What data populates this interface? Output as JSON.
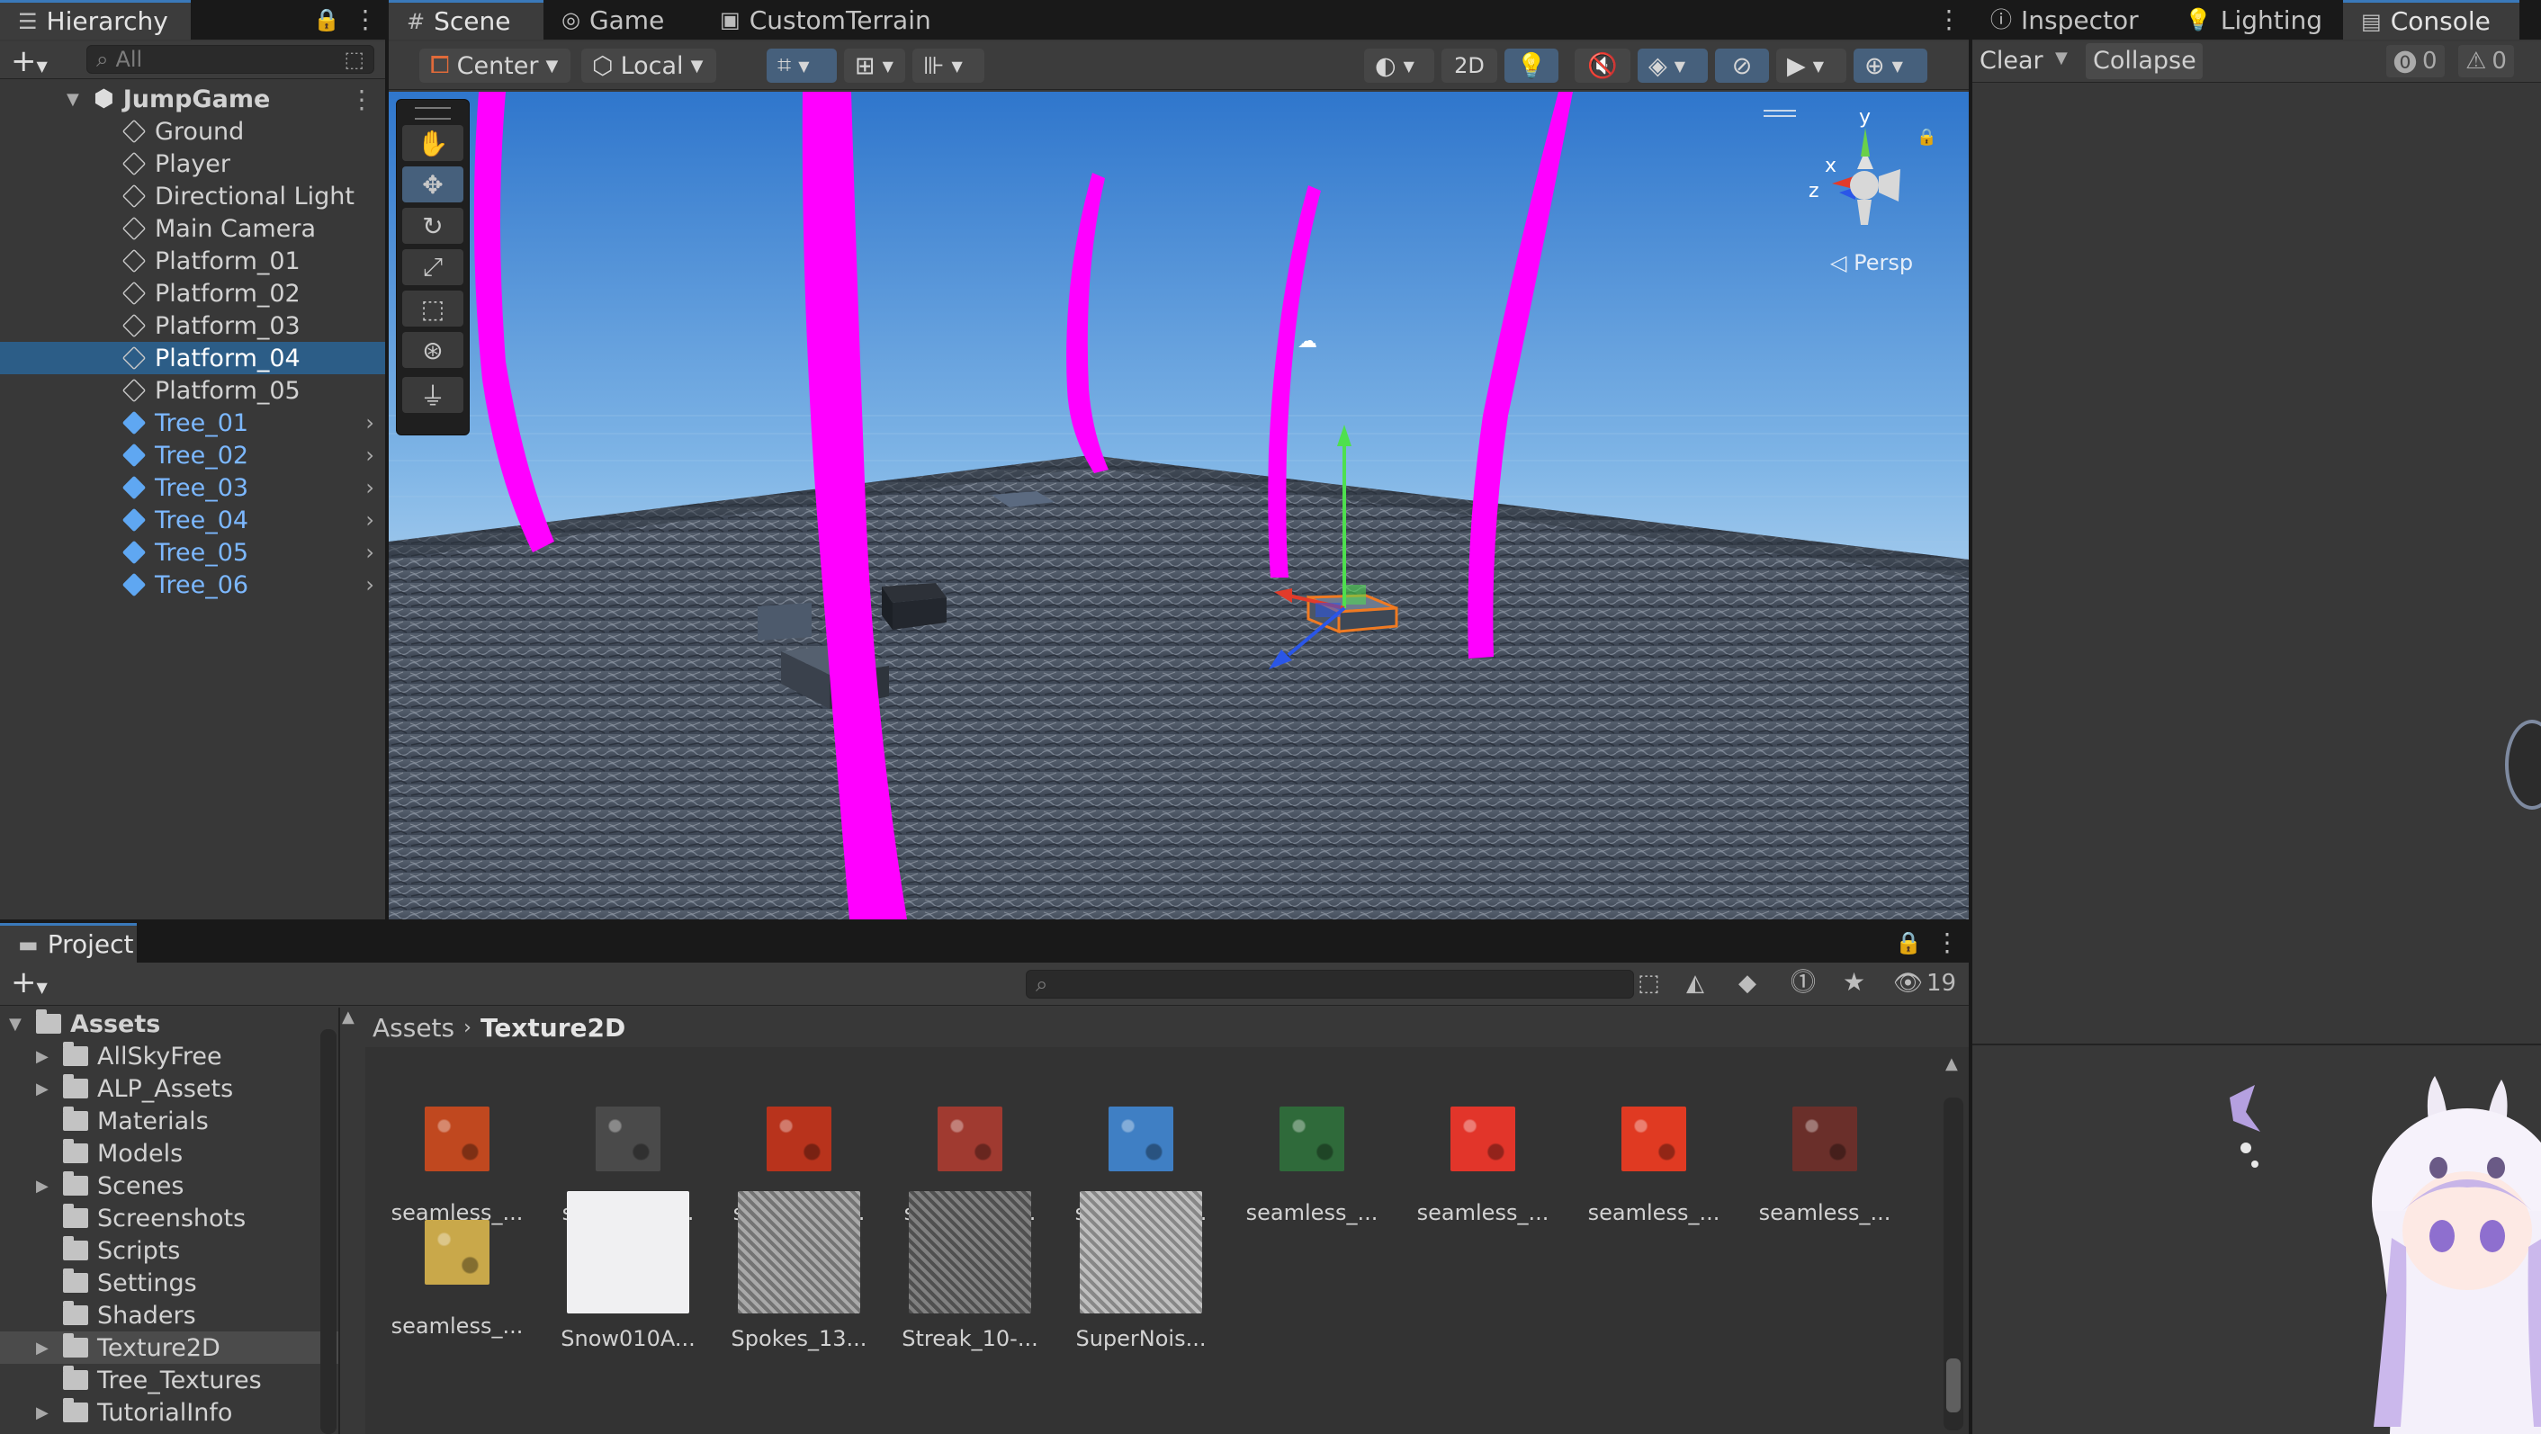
{
  "hierarchy": {
    "tab": "Hierarchy",
    "search_placeholder": "All",
    "root": "JumpGame",
    "items": [
      {
        "label": "Ground",
        "prefab": false
      },
      {
        "label": "Player",
        "prefab": false
      },
      {
        "label": "Directional Light",
        "prefab": false
      },
      {
        "label": "Main Camera",
        "prefab": false
      },
      {
        "label": "Platform_01",
        "prefab": false
      },
      {
        "label": "Platform_02",
        "prefab": false
      },
      {
        "label": "Platform_03",
        "prefab": false
      },
      {
        "label": "Platform_04",
        "prefab": false,
        "selected": true
      },
      {
        "label": "Platform_05",
        "prefab": false
      },
      {
        "label": "Tree_01",
        "prefab": true
      },
      {
        "label": "Tree_02",
        "prefab": true
      },
      {
        "label": "Tree_03",
        "prefab": true
      },
      {
        "label": "Tree_04",
        "prefab": true
      },
      {
        "label": "Tree_05",
        "prefab": true
      },
      {
        "label": "Tree_06",
        "prefab": true
      }
    ]
  },
  "scene": {
    "tabs": [
      "Scene",
      "Game",
      "CustomTerrain"
    ],
    "pivot": "Center",
    "space": "Local",
    "mode_2d": "2D",
    "gizmo": {
      "x": "x",
      "y": "y",
      "z": "z",
      "projection": "Persp"
    }
  },
  "right": {
    "tabs": [
      "Inspector",
      "Lighting",
      "Console"
    ],
    "clear": "Clear",
    "collapse": "Collapse",
    "error_count": "0",
    "warning_count": "0"
  },
  "project": {
    "tab": "Project",
    "hidden_count": "19",
    "breadcrumb": [
      "Assets",
      "Texture2D"
    ],
    "folders": [
      {
        "label": "Assets",
        "depth": 0,
        "expanded": true,
        "bold": true
      },
      {
        "label": "AllSkyFree",
        "depth": 1,
        "arrow": true
      },
      {
        "label": "ALP_Assets",
        "depth": 1,
        "arrow": true
      },
      {
        "label": "Materials",
        "depth": 1
      },
      {
        "label": "Models",
        "depth": 1
      },
      {
        "label": "Scenes",
        "depth": 1,
        "arrow": true
      },
      {
        "label": "Screenshots",
        "depth": 1
      },
      {
        "label": "Scripts",
        "depth": 1
      },
      {
        "label": "Settings",
        "depth": 1
      },
      {
        "label": "Shaders",
        "depth": 1
      },
      {
        "label": "Texture2D",
        "depth": 1,
        "arrow": true,
        "selected": true
      },
      {
        "label": "Tree_Textures",
        "depth": 1
      },
      {
        "label": "TutorialInfo",
        "depth": 1,
        "arrow": true
      }
    ],
    "assets": [
      {
        "name": "seamless_...",
        "color": "#c0481f"
      },
      {
        "name": "seamless_...",
        "color": "#4a4a4a"
      },
      {
        "name": "seamless_...",
        "color": "#b8331c"
      },
      {
        "name": "seamless_...",
        "color": "#a03a30"
      },
      {
        "name": "seamless_...",
        "color": "#3f7fc4"
      },
      {
        "name": "seamless_...",
        "color": "#2f6a3a"
      },
      {
        "name": "seamless_...",
        "color": "#e2352a"
      },
      {
        "name": "seamless_...",
        "color": "#e03a22"
      },
      {
        "name": "seamless_...",
        "color": "#6a2f2a"
      },
      {
        "name": "seamless_...",
        "color": "#c9a84a"
      },
      {
        "name": "Snow010A...",
        "color": "#f0f0f2"
      },
      {
        "name": "Spokes_13...",
        "color": "#9a9a9a"
      },
      {
        "name": "Streak_10-...",
        "color": "#6a6a6a"
      },
      {
        "name": "SuperNois...",
        "color": "#b4b4b4"
      }
    ]
  },
  "colors": {
    "accent": "#3a79bb",
    "selection": "#2c5d87",
    "prefab": "#7cb8ff",
    "magenta": "#ff00ff"
  }
}
